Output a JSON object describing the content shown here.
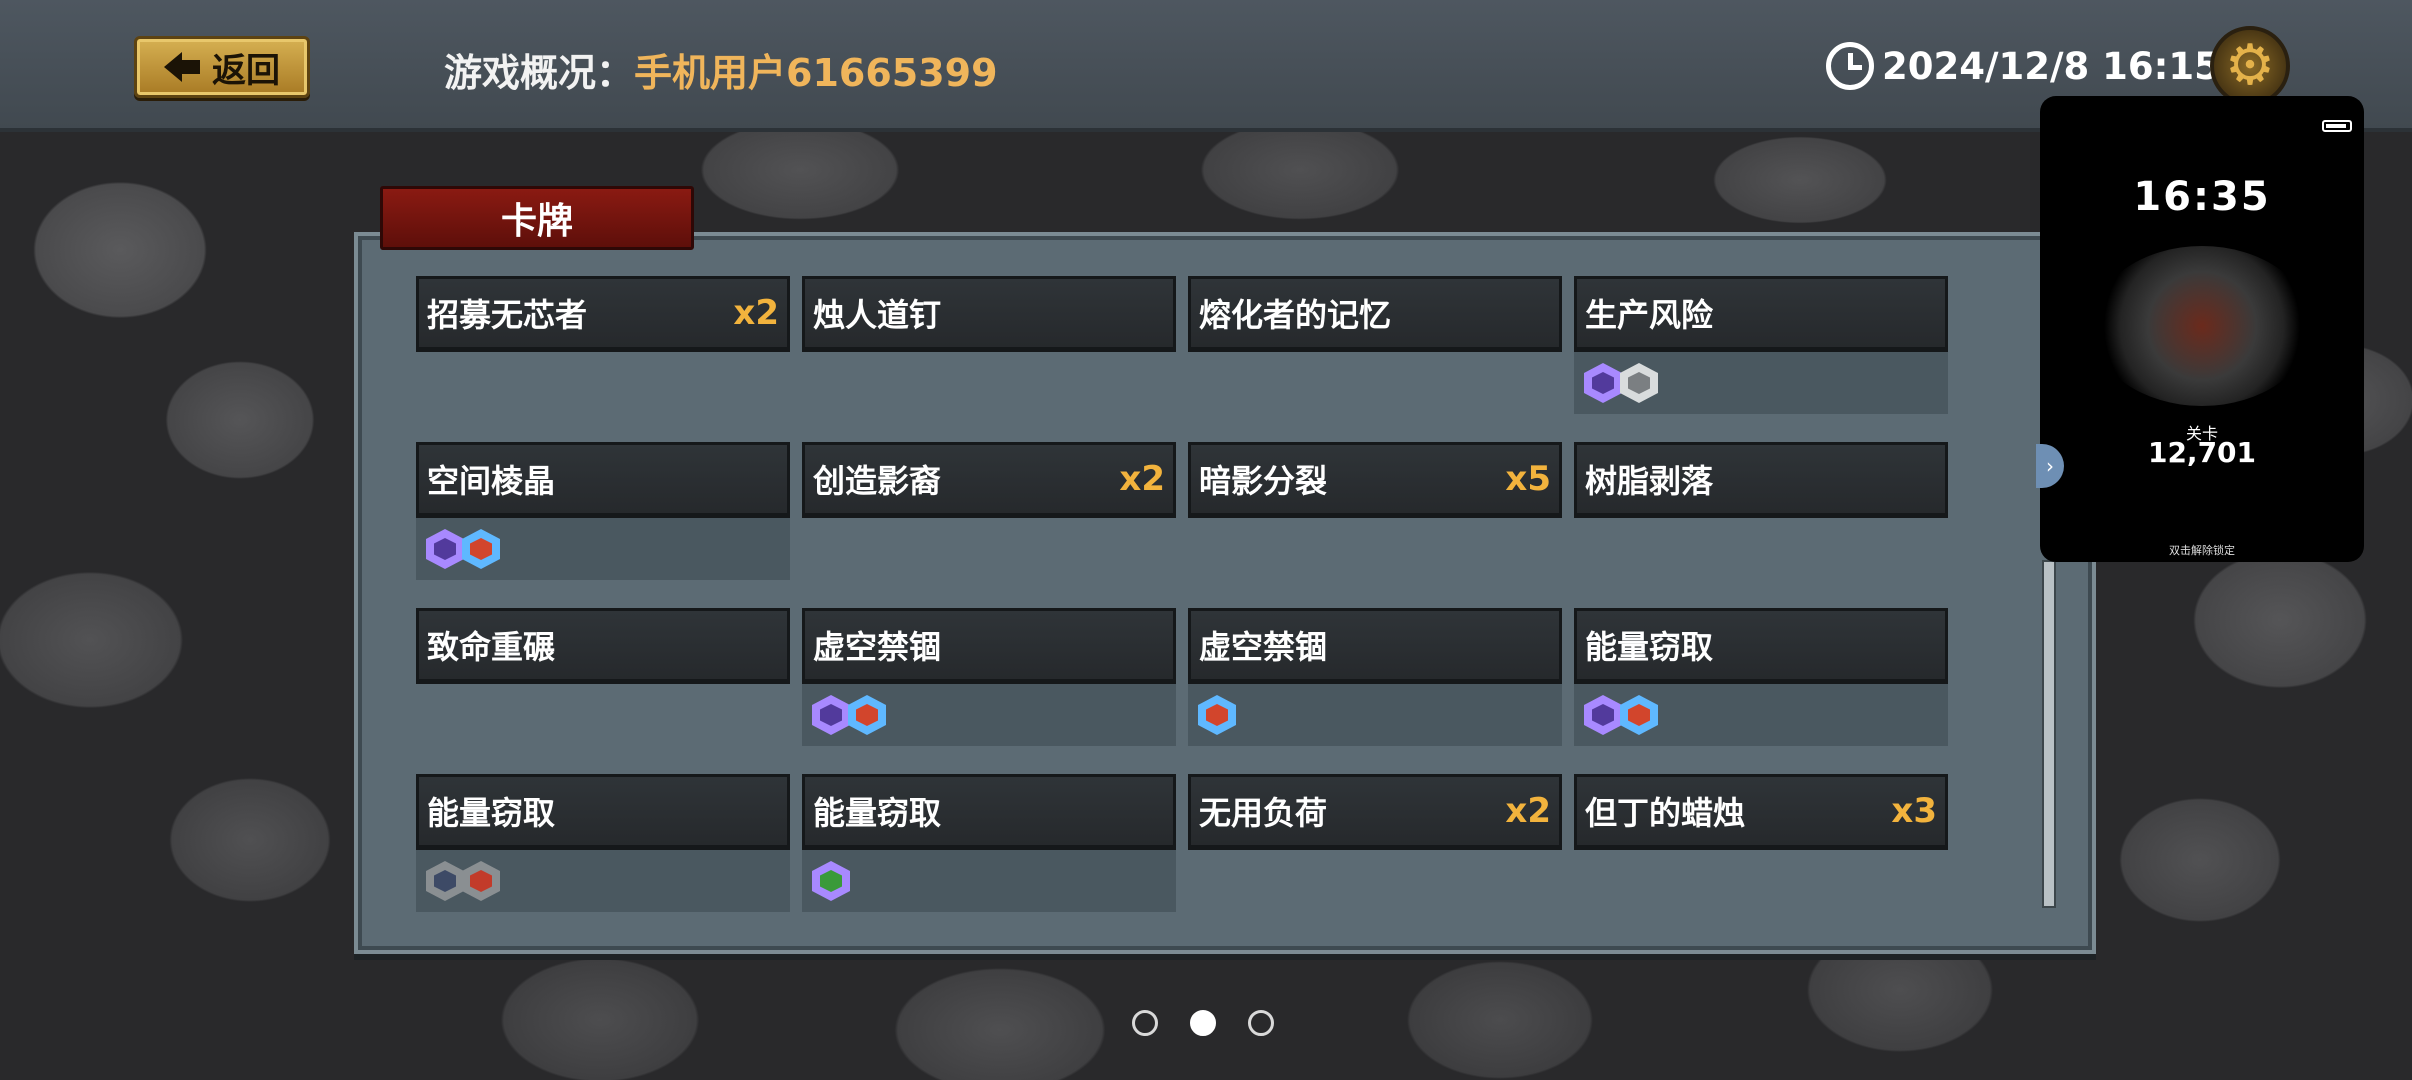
{
  "header": {
    "back_label": "返回",
    "title_prefix": "游戏概况：",
    "user_name": "手机用户61665399",
    "datetime": "2024/12/8 16:15"
  },
  "panel": {
    "tab_label": "卡牌",
    "cards": [
      {
        "name": "招募无芯者",
        "count": "x2",
        "icons": []
      },
      {
        "name": "烛人道钉",
        "count": "",
        "icons": []
      },
      {
        "name": "熔化者的记忆",
        "count": "",
        "icons": []
      },
      {
        "name": "生产风险",
        "count": "",
        "icons": [
          "purple-hex-icon",
          "white-hex-icon"
        ]
      },
      {
        "name": "空间棱晶",
        "count": "",
        "icons": [
          "purple-hex-icon",
          "blue-hex-icon"
        ]
      },
      {
        "name": "创造影裔",
        "count": "x2",
        "icons": []
      },
      {
        "name": "暗影分裂",
        "count": "x5",
        "icons": []
      },
      {
        "name": "树脂剥落",
        "count": "",
        "icons": []
      },
      {
        "name": "致命重碾",
        "count": "",
        "icons": []
      },
      {
        "name": "虚空禁锢",
        "count": "",
        "icons": [
          "purple-hex-icon",
          "blue-hex-icon"
        ]
      },
      {
        "name": "虚空禁锢",
        "count": "",
        "icons": [
          "blue-hex-icon"
        ]
      },
      {
        "name": "能量窃取",
        "count": "",
        "icons": [
          "purple-hex-icon",
          "blue-hex-icon"
        ]
      },
      {
        "name": "能量窃取",
        "count": "",
        "icons": [
          "gray-hex-icon",
          "red-hex-icon"
        ]
      },
      {
        "name": "能量窃取",
        "count": "",
        "icons": [
          "green-hex-icon"
        ]
      },
      {
        "name": "无用负荷",
        "count": "x2",
        "icons": []
      },
      {
        "name": "但丁的蜡烛",
        "count": "x3",
        "icons": []
      }
    ]
  },
  "pagination": {
    "pages": 3,
    "active_index": 1
  },
  "phone_overlay": {
    "time": "16:35",
    "label": "关卡",
    "value": "12,701",
    "footer": "双击解除锁定"
  },
  "colors": {
    "accent_gold": "#f0b55b",
    "count_gold": "#f2b33d",
    "tab_red": "#8a1a12",
    "panel_bg": "#5c6b74"
  }
}
